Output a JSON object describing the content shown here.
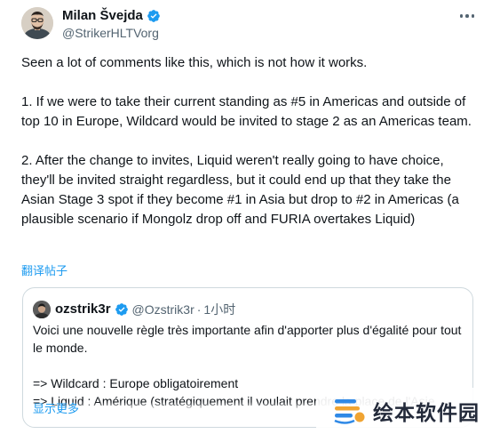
{
  "author": {
    "name": "Milan Švejda",
    "handle": "@StrikerHLTVorg",
    "verified_color": "#1d9bf0"
  },
  "tweet": {
    "paragraphs": [
      "Seen a lot of comments like this, which is not how it works.",
      "1. If we were to take their current standing as #5 in Americas and outside of top 10 in Europe, Wildcard would be invited to stage 2 as an Americas team.",
      "2. After the change to invites, Liquid weren't really going to have choice, they'll be invited straight regardless, but it could end up that they take the Asian Stage 3 spot if they become #1 in Asia but drop to #2 in Americas (a plausible scenario if Mongolz drop off and FURIA overtakes Liquid)"
    ],
    "translate_label": "翻译帖子"
  },
  "quote": {
    "name": "ozstrik3r",
    "handle": "@Ozstrik3r",
    "separator": "·",
    "time": "1小时",
    "lines": [
      "Voici une nouvelle règle très importante afin d'apporter plus d'égalité pour tout le monde.",
      "=> Wildcard : Europe obligatoirement",
      "=> Liquid : Amérique (stratégiquement il voulait prendre la place de l'Asie"
    ],
    "show_more_label": "显示更多"
  },
  "watermark": {
    "text": "绘本软件园"
  },
  "colors": {
    "link": "#1d9bf0",
    "secondary_text": "#536471",
    "border": "#cfd9de",
    "primary_text": "#0f1419"
  },
  "icons": {
    "verified": "verified-badge-icon",
    "more": "more-dots-icon"
  }
}
